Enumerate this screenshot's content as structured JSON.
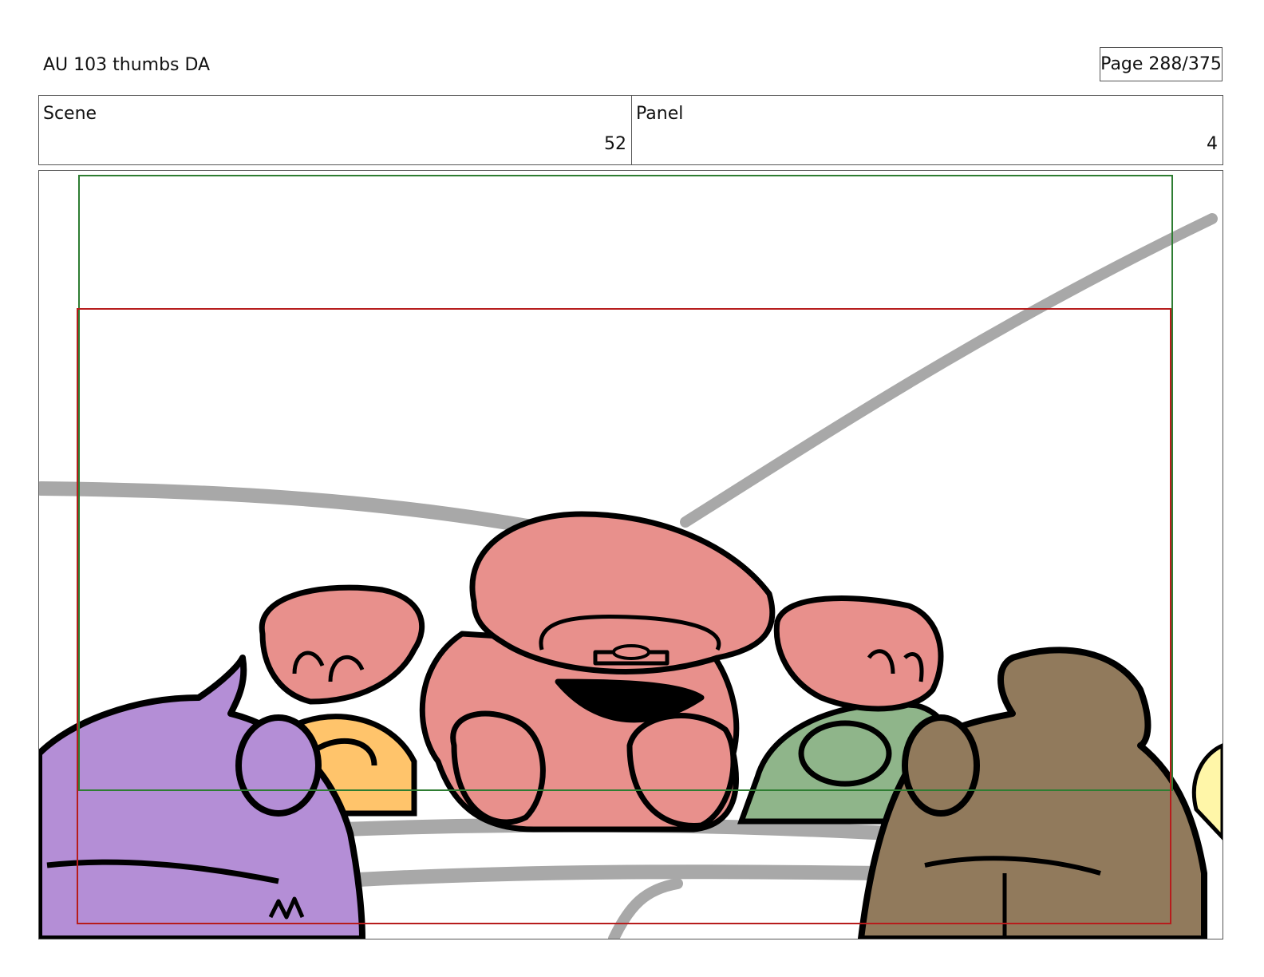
{
  "document": {
    "title": "AU 103 thumbs DA",
    "page_label": "Page 288/375"
  },
  "info": {
    "scene_label": "Scene",
    "scene_value": "52",
    "panel_label": "Panel",
    "panel_value": "4"
  },
  "colors": {
    "safe_frame": "#2e7d32",
    "action_frame": "#b71c1c",
    "red_character": "#e8908c",
    "purple_character": "#b48ed6",
    "yellow_character": "#ffc46b",
    "green_character": "#8fb58a",
    "brown_character": "#917a5c",
    "background_lines": "#a8a8a8"
  }
}
